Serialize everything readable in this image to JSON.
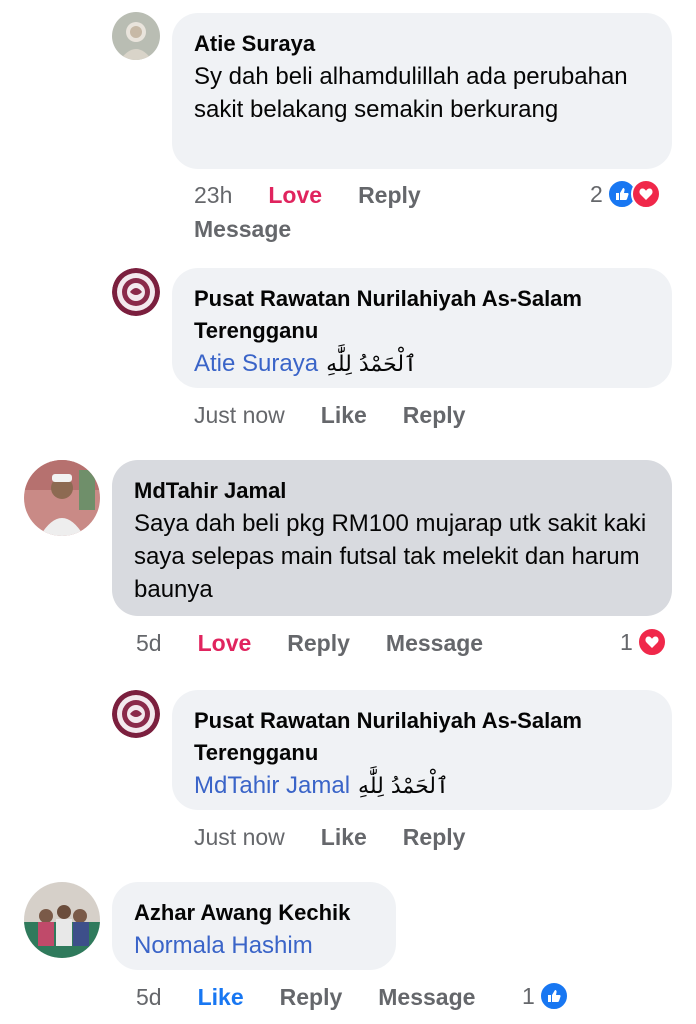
{
  "comments": [
    {
      "author": "Atie Suraya",
      "text": "Sy dah beli alhamdulillah ada perubahan sakit belakang semakin berkurang",
      "time": "23h",
      "reaction_action": "Love",
      "reply": "Reply",
      "message": "Message",
      "react_count": "2",
      "react_icons": [
        "like-icon",
        "heart-icon"
      ]
    },
    {
      "author": "Pusat Rawatan Nurilahiyah As-Salam Terengganu",
      "mention": "Atie Suraya",
      "arabic": "ٱلْحَمْدُ لِلَّٰهِ",
      "time": "Just now",
      "like": "Like",
      "reply": "Reply"
    },
    {
      "author": "MdTahir Jamal",
      "text": "Saya dah beli pkg RM100  mujarap utk sakit kaki saya selepas main futsal tak melekit dan harum baunya",
      "time": "5d",
      "reaction_action": "Love",
      "reply": "Reply",
      "message": "Message",
      "react_count": "1",
      "react_icons": [
        "heart-icon"
      ]
    },
    {
      "author": "Pusat Rawatan Nurilahiyah As-Salam Terengganu",
      "mention": "MdTahir Jamal",
      "arabic": "ٱلْحَمْدُ لِلَّٰهِ",
      "time": "Just now",
      "like": "Like",
      "reply": "Reply"
    },
    {
      "author": "Azhar Awang Kechik",
      "mention": "Normala Hashim",
      "time": "5d",
      "reaction_action": "Like",
      "reply": "Reply",
      "message": "Message",
      "react_count": "1",
      "react_icons": [
        "like-icon"
      ]
    }
  ],
  "colors": {
    "love": "#e0245e",
    "like": "#1877f2",
    "mention": "#3a64c8",
    "bubble": "#f0f2f5"
  }
}
